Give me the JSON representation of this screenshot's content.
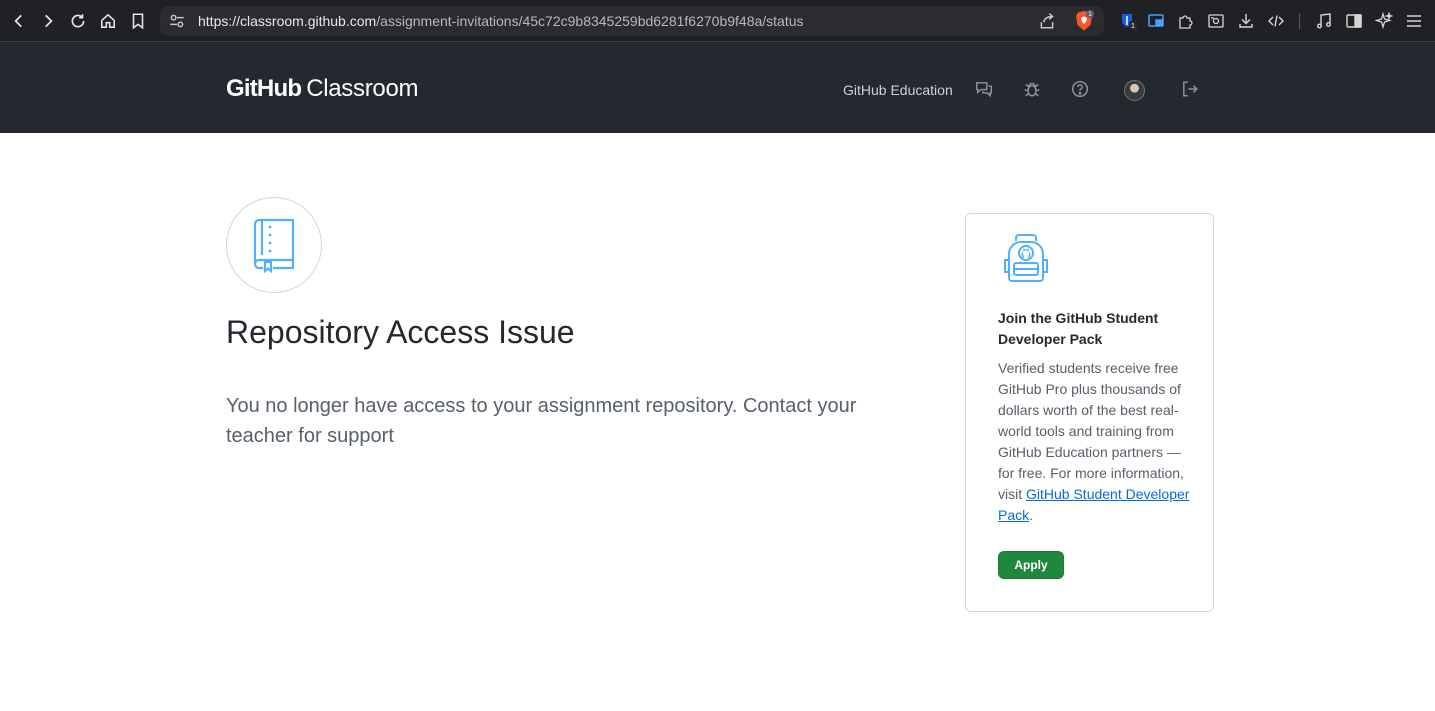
{
  "browser": {
    "url_host": "https://classroom.github.com",
    "url_path": "/assignment-invitations/45c72c9b8345259bd6281f6270b9f48a/status",
    "brave_badge": "1",
    "ext_badge": "1"
  },
  "header": {
    "logo_bold": "GitHub",
    "logo_light": "Classroom",
    "nav_link": "GitHub Education",
    "icons": [
      "feedback-icon",
      "bug-icon",
      "help-icon",
      "avatar",
      "sign-out-icon"
    ]
  },
  "main": {
    "title": "Repository Access Issue",
    "description": "You no longer have access to your assignment repository. Contact your teacher for support"
  },
  "card": {
    "title": "Join the GitHub Student Developer Pack",
    "body_text": "Verified students receive free GitHub Pro plus thousands of dollars worth of the best real-world tools and training from GitHub Education partners — for free. For more information, visit ",
    "link_text": "GitHub Student Developer Pack",
    "body_end": ".",
    "apply_label": "Apply"
  },
  "colors": {
    "header_bg": "#24292f",
    "accent_green": "#1f883d",
    "link_blue": "#0969da",
    "icon_blue": "#54aeff"
  }
}
